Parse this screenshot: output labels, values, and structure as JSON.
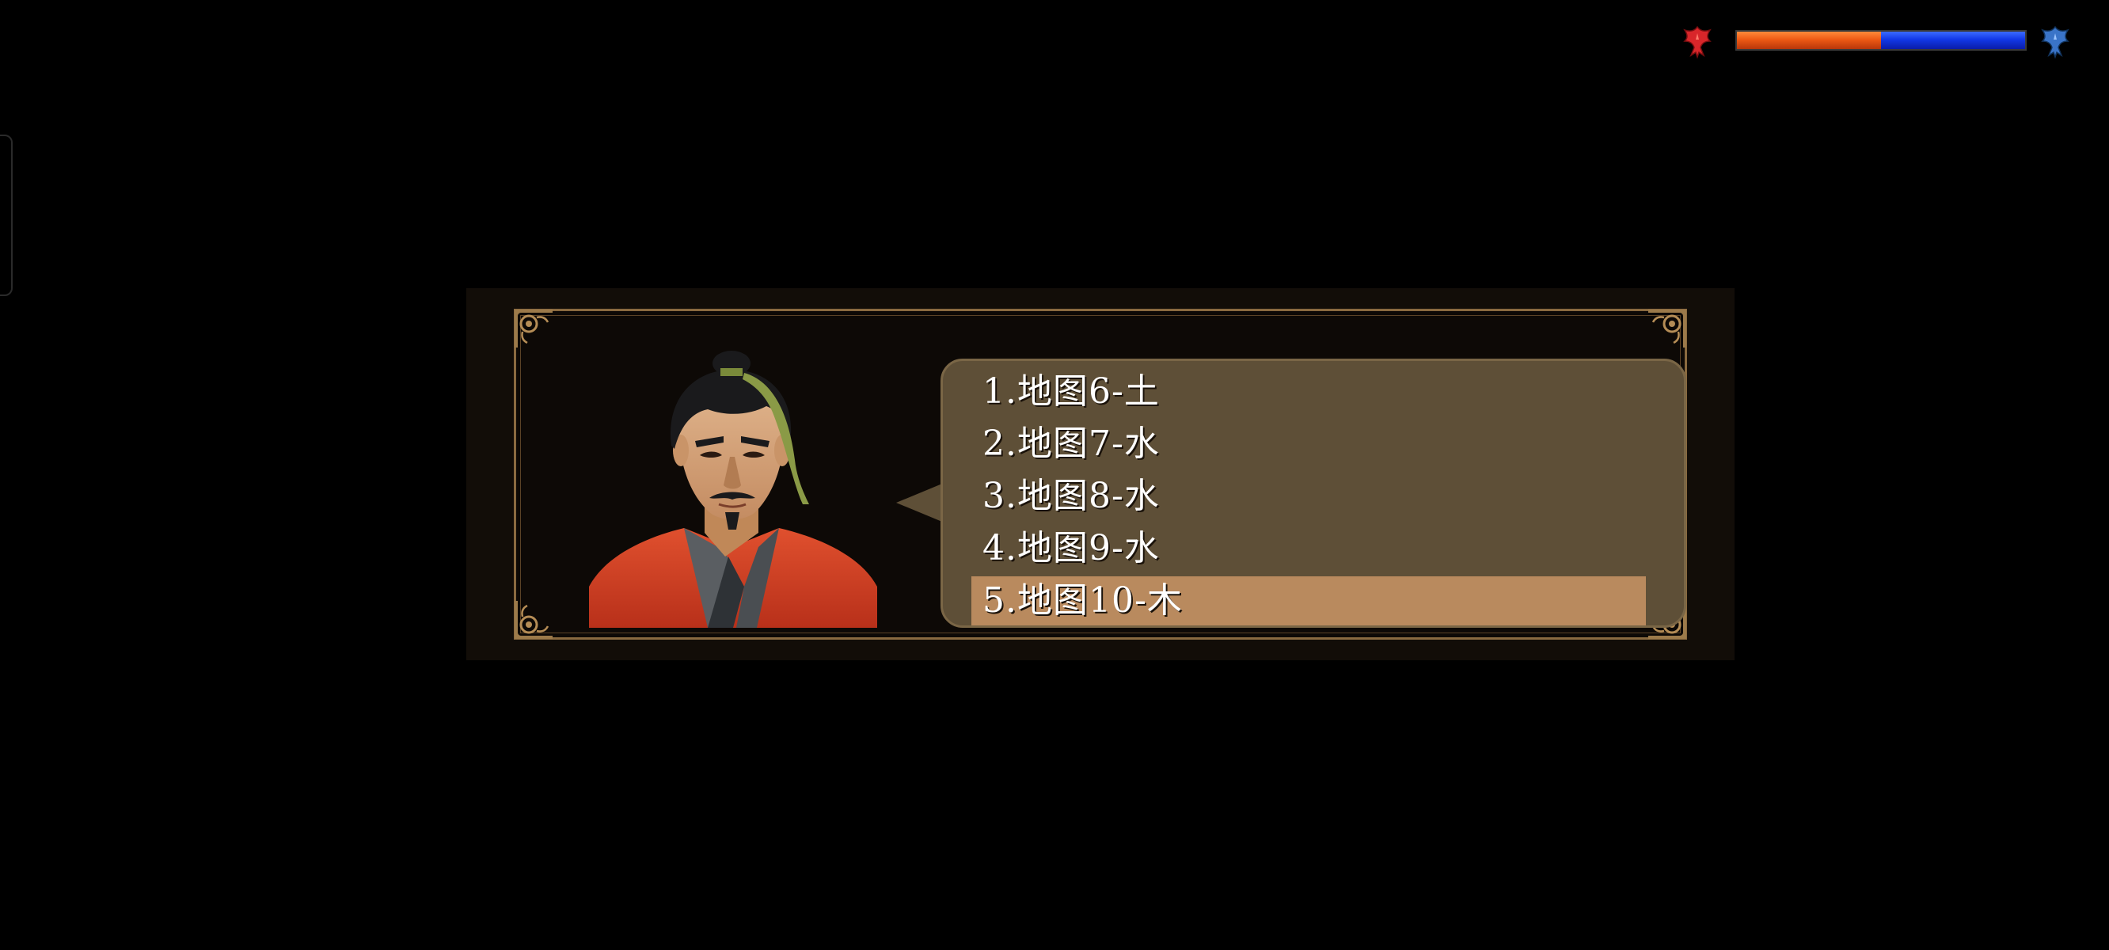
{
  "hud": {
    "force_bar": {
      "red_share": 0.5,
      "red_color": "#ee5a14",
      "blue_color": "#1238e6",
      "left_icon": "red-phoenix-icon",
      "right_icon": "blue-phoenix-icon"
    }
  },
  "dialog": {
    "portrait": "general-portrait",
    "options": [
      {
        "label": "1.地图6-土",
        "selected": false
      },
      {
        "label": "2.地图7-水",
        "selected": false
      },
      {
        "label": "3.地图8-水",
        "selected": false
      },
      {
        "label": "4.地图9-水",
        "selected": false
      },
      {
        "label": "5.地图10-木",
        "selected": true
      }
    ],
    "colors": {
      "bubble": "#5e4f37",
      "highlight": "#b98a5e",
      "frame": "#8a6a40"
    }
  }
}
